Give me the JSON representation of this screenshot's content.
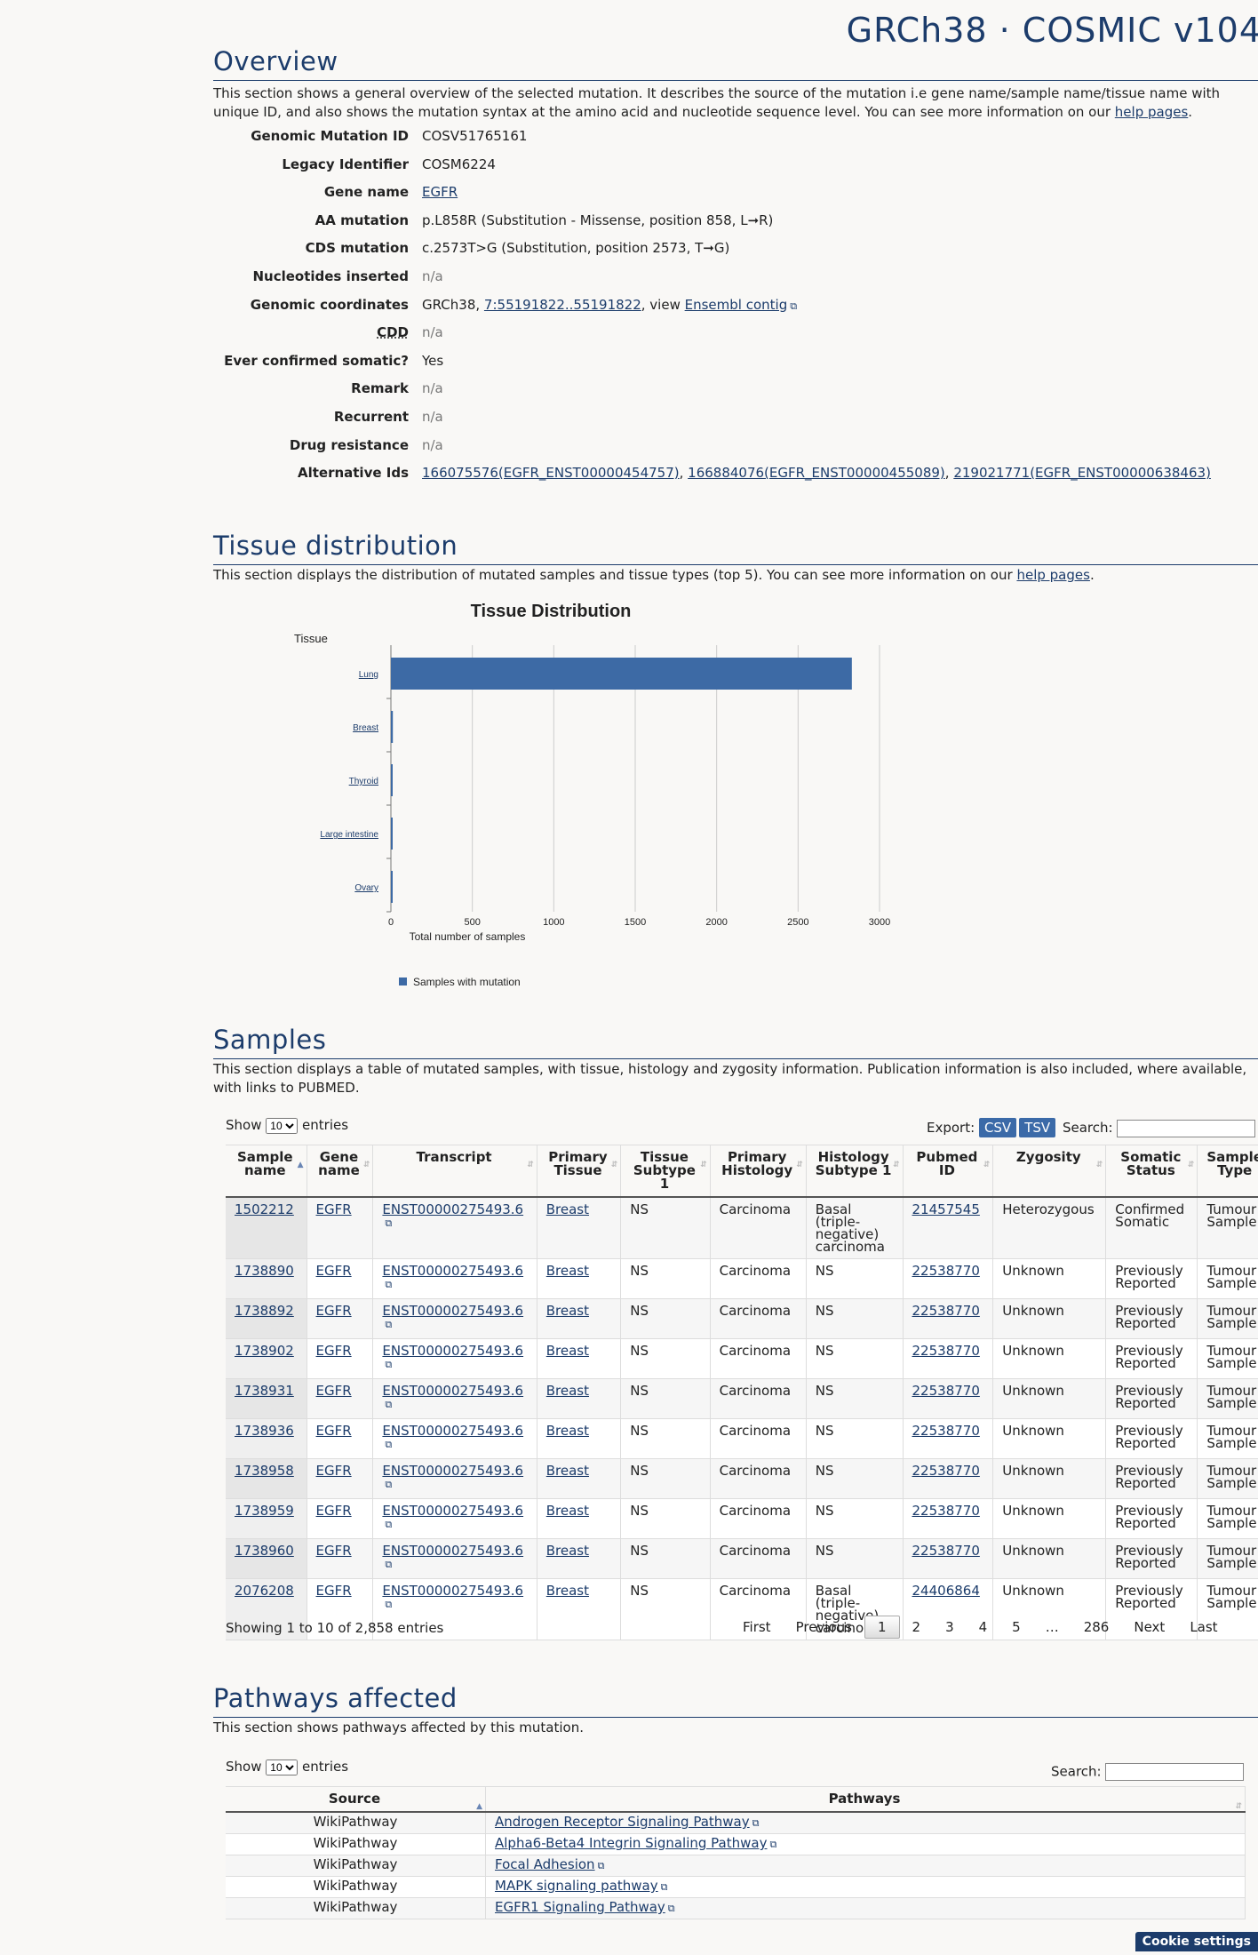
{
  "header": {
    "build": "GRCh38 · COSMIC v104"
  },
  "overview": {
    "title": "Overview",
    "intro": "This section shows a general overview of the selected mutation. It describes the source of the mutation i.e gene name/sample name/tissue name with unique ID, and also shows the mutation syntax at the amino acid and nucleotide sequence level. You can see more information on our",
    "help_link": "help pages",
    "rows": {
      "genomic_mutation_id": {
        "label": "Genomic Mutation ID",
        "value": "COSV51765161"
      },
      "legacy_identifier": {
        "label": "Legacy Identifier",
        "value": "COSM6224"
      },
      "gene_name": {
        "label": "Gene name",
        "value": "EGFR"
      },
      "aa_mutation": {
        "label": "AA mutation",
        "value": "p.L858R (Substitution - Missense, position 858, L➞R)"
      },
      "cds_mutation": {
        "label": "CDS mutation",
        "value": "c.2573T>G (Substitution, position 2573, T➞G)"
      },
      "nucleotides_inserted": {
        "label": "Nucleotides inserted",
        "value": "n/a"
      },
      "genomic_coordinates": {
        "label": "Genomic coordinates",
        "prefix": "GRCh38,",
        "link": "7:55191822..55191822",
        "mid": ", view",
        "ensembl": "Ensembl contig"
      },
      "cdd": {
        "label": "CDD",
        "value": "n/a"
      },
      "ever_confirmed_somatic": {
        "label": "Ever confirmed somatic?",
        "value": "Yes"
      },
      "remark": {
        "label": "Remark",
        "value": "n/a"
      },
      "recurrent": {
        "label": "Recurrent",
        "value": "n/a"
      },
      "drug_resistance": {
        "label": "Drug resistance",
        "value": "n/a"
      },
      "alternative_ids": {
        "label": "Alternative Ids",
        "ids": [
          "166075576(EGFR_ENST00000454757)",
          "166884076(EGFR_ENST00000455089)",
          "219021771(EGFR_ENST00000638463)"
        ]
      }
    }
  },
  "tissue": {
    "title": "Tissue distribution",
    "intro": "This section displays the distribution of mutated samples and tissue types (top 5). You can see more information on our",
    "help_link": "help pages"
  },
  "chart_data": {
    "type": "bar",
    "orientation": "horizontal",
    "title": "Tissue Distribution",
    "ylabel": "Tissue",
    "xlabel": "Total number of samples",
    "categories": [
      "Lung",
      "Breast",
      "Thyroid",
      "Large intestine",
      "Ovary"
    ],
    "series": [
      {
        "name": "Samples with mutation",
        "values": [
          2830,
          12,
          8,
          6,
          5
        ]
      }
    ],
    "xlim": [
      0,
      3000
    ],
    "xticks": [
      "0",
      "500",
      "1000",
      "1500",
      "2000",
      "2500",
      "3000"
    ],
    "grid": true,
    "legend": "bottom-left",
    "color": "#3d6aa5"
  },
  "samples": {
    "title": "Samples",
    "intro": "This section displays a table of mutated samples, with tissue, histology and zygosity information. Publication information is also included, where available, with links to PUBMED.",
    "show": "Show",
    "entries": "entries",
    "page_size": "10",
    "export": "Export:",
    "csv": "CSV",
    "tsv": "TSV",
    "search": "Search:",
    "columns": [
      "Sample name",
      "Gene name",
      "Transcript",
      "Primary Tissue",
      "Tissue Subtype 1",
      "Primary Histology",
      "Histology Subtype 1",
      "Pubmed ID",
      "Zygosity",
      "Somatic Status",
      "Sample Type"
    ],
    "rows": [
      [
        "1502212",
        "EGFR",
        "ENST00000275493.6",
        "Breast",
        "NS",
        "Carcinoma",
        "Basal (triple-negative) carcinoma",
        "21457545",
        "Heterozygous",
        "Confirmed Somatic",
        "Tumour Sample"
      ],
      [
        "1738890",
        "EGFR",
        "ENST00000275493.6",
        "Breast",
        "NS",
        "Carcinoma",
        "NS",
        "22538770",
        "Unknown",
        "Previously Reported",
        "Tumour Sample"
      ],
      [
        "1738892",
        "EGFR",
        "ENST00000275493.6",
        "Breast",
        "NS",
        "Carcinoma",
        "NS",
        "22538770",
        "Unknown",
        "Previously Reported",
        "Tumour Sample"
      ],
      [
        "1738902",
        "EGFR",
        "ENST00000275493.6",
        "Breast",
        "NS",
        "Carcinoma",
        "NS",
        "22538770",
        "Unknown",
        "Previously Reported",
        "Tumour Sample"
      ],
      [
        "1738931",
        "EGFR",
        "ENST00000275493.6",
        "Breast",
        "NS",
        "Carcinoma",
        "NS",
        "22538770",
        "Unknown",
        "Previously Reported",
        "Tumour Sample"
      ],
      [
        "1738936",
        "EGFR",
        "ENST00000275493.6",
        "Breast",
        "NS",
        "Carcinoma",
        "NS",
        "22538770",
        "Unknown",
        "Previously Reported",
        "Tumour Sample"
      ],
      [
        "1738958",
        "EGFR",
        "ENST00000275493.6",
        "Breast",
        "NS",
        "Carcinoma",
        "NS",
        "22538770",
        "Unknown",
        "Previously Reported",
        "Tumour Sample"
      ],
      [
        "1738959",
        "EGFR",
        "ENST00000275493.6",
        "Breast",
        "NS",
        "Carcinoma",
        "NS",
        "22538770",
        "Unknown",
        "Previously Reported",
        "Tumour Sample"
      ],
      [
        "1738960",
        "EGFR",
        "ENST00000275493.6",
        "Breast",
        "NS",
        "Carcinoma",
        "NS",
        "22538770",
        "Unknown",
        "Previously Reported",
        "Tumour Sample"
      ],
      [
        "2076208",
        "EGFR",
        "ENST00000275493.6",
        "Breast",
        "NS",
        "Carcinoma",
        "Basal (triple-negative) carcinoma",
        "24406864",
        "Unknown",
        "Previously Reported",
        "Tumour Sample"
      ]
    ],
    "info": "Showing 1 to 10 of 2,858 entries",
    "pager": {
      "first": "First",
      "previous": "Previous",
      "pages": [
        "1",
        "2",
        "3",
        "4",
        "5",
        "…",
        "286"
      ],
      "next": "Next",
      "last": "Last"
    }
  },
  "pathways": {
    "title": "Pathways affected",
    "intro": "This section shows pathways affected by this mutation.",
    "show": "Show",
    "entries": "entries",
    "page_size": "10",
    "search": "Search:",
    "columns": [
      "Source",
      "Pathways"
    ],
    "rows": [
      [
        "WikiPathway",
        "Androgen Receptor Signaling Pathway"
      ],
      [
        "WikiPathway",
        "Alpha6-Beta4 Integrin Signaling Pathway"
      ],
      [
        "WikiPathway",
        "Focal Adhesion"
      ],
      [
        "WikiPathway",
        "MAPK signaling pathway"
      ],
      [
        "WikiPathway",
        "EGFR1 Signaling Pathway"
      ]
    ]
  },
  "cookie": {
    "label": "Cookie settings"
  }
}
